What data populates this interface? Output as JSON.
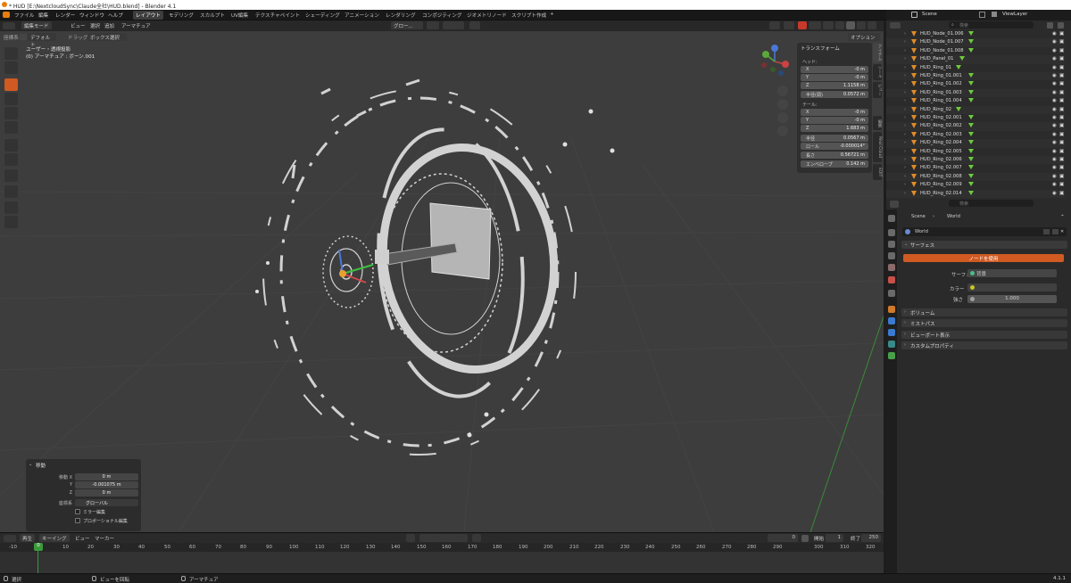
{
  "window": {
    "title": "* HUD [E:\\NextcloudSync\\Claude全社\\HUD.blend] - Blender 4.1"
  },
  "menu": [
    "ファイル",
    "編集",
    "レンダー",
    "ウィンドウ",
    "ヘルプ"
  ],
  "workspaces": [
    "レイアウト",
    "モデリング",
    "スカルプト",
    "UV編集",
    "テクスチャペイント",
    "シェーディング",
    "アニメーション",
    "レンダリング",
    "コンポジティング",
    "ジオメトリノード",
    "スクリプト作成",
    "+"
  ],
  "active_workspace": "レイアウト",
  "outliner_header": {
    "scene": "Scene",
    "view_layer": "ViewLayer"
  },
  "viewport_header": {
    "mode": "編集モード",
    "view": "ビュー",
    "select": "選択",
    "add": "追加",
    "armature": "アーマチュア",
    "transform_orientation": "グロー...",
    "coordinate_label": "座標系",
    "default": "デフォルト",
    "drag": "ドラッグ",
    "box_select": "ボックス選択",
    "options": "オプション"
  },
  "viewport_overlay": {
    "view_name": "ユーザー・透視投影",
    "object_info": "(0) アーマチュア : ボーン.001"
  },
  "npanel": {
    "title": "トランスフォーム",
    "head_label": "ヘッド:",
    "head": [
      {
        "axis": "X",
        "value": "-0 m"
      },
      {
        "axis": "Y",
        "value": "-0 m"
      },
      {
        "axis": "Z",
        "value": "1.1158 m"
      }
    ],
    "head_radius": {
      "label": "半径(頭)",
      "value": "0.0572 m"
    },
    "tail_label": "テール:",
    "tail": [
      {
        "axis": "X",
        "value": "-0 m"
      },
      {
        "axis": "Y",
        "value": "-0 m"
      },
      {
        "axis": "Z",
        "value": "1.683 m"
      }
    ],
    "extras": [
      {
        "label": "半径",
        "value": "0.0567 m"
      },
      {
        "label": "ロール",
        "value": "-0.000014°"
      },
      {
        "label": "長さ",
        "value": "0.56721 m"
      },
      {
        "label": "エンベロープ",
        "value": "0.142 m"
      }
    ]
  },
  "side_tabs": [
    "アイテム",
    "ツール",
    "ビュー",
    "編集",
    "Real Cloud",
    "EDIT"
  ],
  "operator_panel": {
    "title": "移動",
    "move_x_label": "移動 X",
    "move_x": "0 m",
    "y_label": "Y",
    "move_y": "-0.001075 m",
    "z_label": "Z",
    "move_z": "0 m",
    "orient_label": "座標系",
    "orient_value": "グローバル",
    "mirror": "ミラー編集",
    "proportional": "プロポーショナル編集"
  },
  "timeline": {
    "playback": "再生",
    "keying": "キーイング",
    "view": "ビュー",
    "marker": "マーカー",
    "current_frame": "0",
    "start_label": "開始",
    "start": "1",
    "end_label": "終了",
    "end": "250",
    "frames": [
      "-10",
      "0",
      "10",
      "20",
      "30",
      "40",
      "50",
      "60",
      "70",
      "80",
      "90",
      "100",
      "110",
      "120",
      "130",
      "140",
      "150",
      "160",
      "170",
      "180",
      "190",
      "200",
      "210",
      "220",
      "230",
      "240",
      "250",
      "260",
      "270",
      "280",
      "290",
      "300",
      "310",
      "320"
    ]
  },
  "status": {
    "select": "選択",
    "rotate_view": "ビューを回転",
    "armature": "アーマチュア",
    "version": "4.1.1"
  },
  "outliner": {
    "search_placeholder": "検索",
    "items": [
      "HUD_Node_01.006",
      "HUD_Node_01.007",
      "HUD_Node_01.008",
      "HUD_Panel_01",
      "HUD_Ring_01",
      "HUD_Ring_01.001",
      "HUD_Ring_01.002",
      "HUD_Ring_01.003",
      "HUD_Ring_01.004",
      "HUD_Ring_02",
      "HUD_Ring_02.001",
      "HUD_Ring_02.002",
      "HUD_Ring_02.003",
      "HUD_Ring_02.004",
      "HUD_Ring_02.005",
      "HUD_Ring_02.006",
      "HUD_Ring_02.007",
      "HUD_Ring_02.008",
      "HUD_Ring_02.009",
      "HUD_Ring_02.014"
    ]
  },
  "properties": {
    "search_placeholder": "検索",
    "breadcrumb_scene": "Scene",
    "breadcrumb_world": "World",
    "world_name": "World",
    "surface_section": "サーフェス",
    "use_nodes": "ノードを使用",
    "surface_label": "サーフェス",
    "surface_value": "背景",
    "color_label": "カラー",
    "strength_label": "強さ",
    "strength_value": "1.000",
    "sections": [
      "ボリューム",
      "ミストパス",
      "ビューポート表示",
      "カスタムプロパティ"
    ]
  },
  "colors": {
    "accent_orange": "#d05a22",
    "viewport_bg": "#3d3d3d",
    "frame_marker": "#3a9a3a"
  }
}
